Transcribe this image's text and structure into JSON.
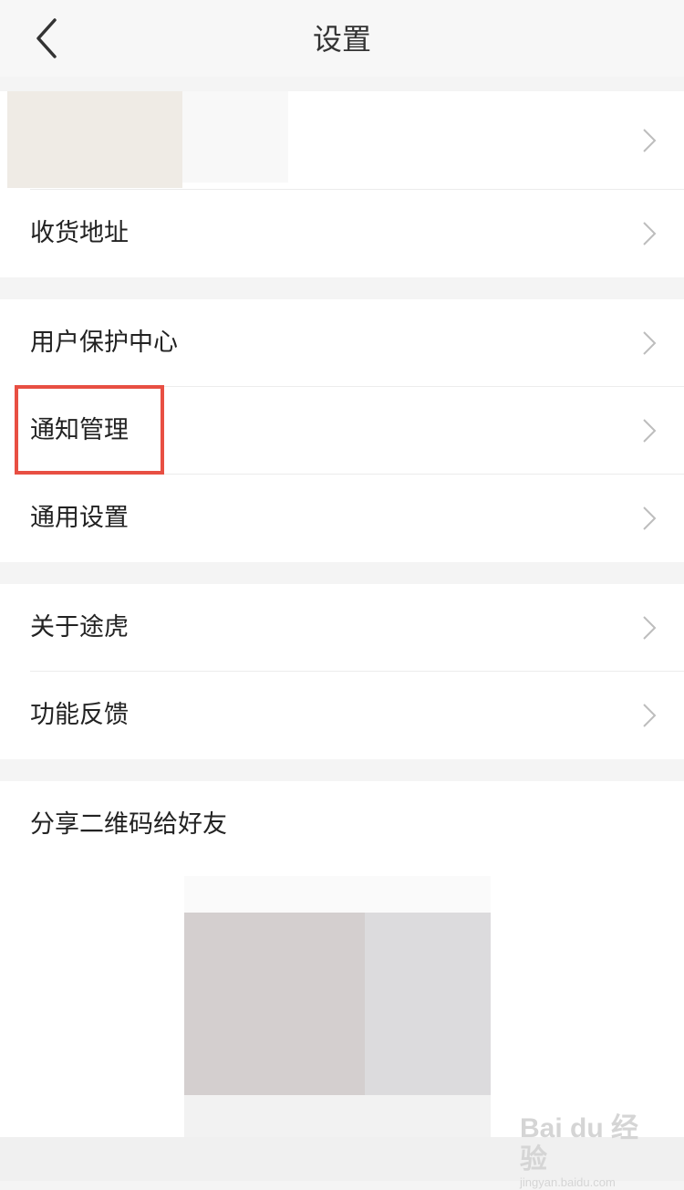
{
  "header": {
    "title": "设置"
  },
  "groups": [
    {
      "items": [
        {
          "label": ""
        },
        {
          "label": "收货地址"
        }
      ]
    },
    {
      "items": [
        {
          "label": "用户保护中心"
        },
        {
          "label": "通知管理"
        },
        {
          "label": "通用设置"
        }
      ]
    },
    {
      "items": [
        {
          "label": "关于途虎"
        },
        {
          "label": "功能反馈"
        }
      ]
    }
  ],
  "share": {
    "title": "分享二维码给好友"
  },
  "watermark": {
    "main": "Bai du 经验",
    "sub": "jingyan.baidu.com"
  },
  "icons": {
    "back": "chevron-left-icon",
    "row": "chevron-right-icon"
  },
  "colors": {
    "highlight": "#e84f43",
    "background": "#f4f4f4",
    "text": "#222222"
  }
}
